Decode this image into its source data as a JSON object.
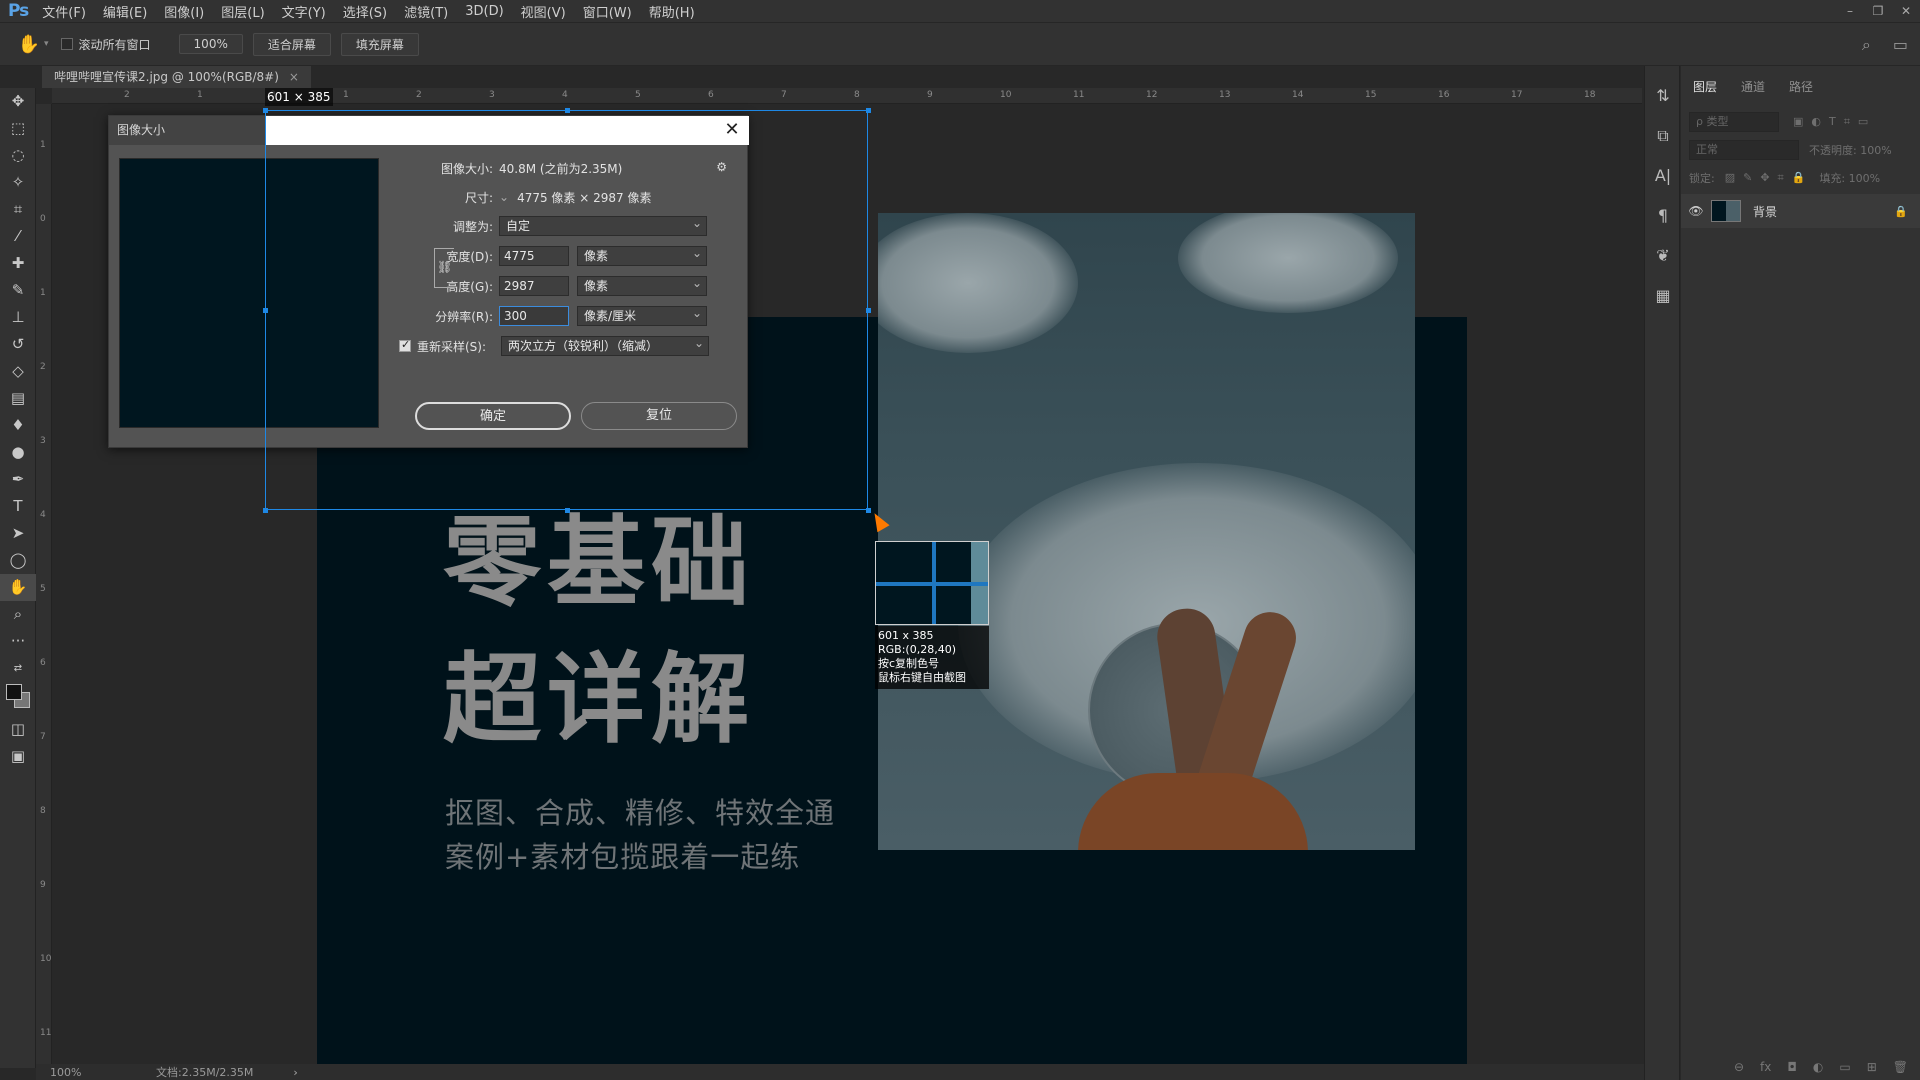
{
  "app": {
    "logo": "Ps"
  },
  "menu": [
    "文件(F)",
    "编辑(E)",
    "图像(I)",
    "图层(L)",
    "文字(Y)",
    "选择(S)",
    "滤镜(T)",
    "3D(D)",
    "视图(V)",
    "窗口(W)",
    "帮助(H)"
  ],
  "window_controls": [
    "–",
    "❐",
    "✕"
  ],
  "options": {
    "scroll_all": "滚动所有窗口",
    "zoom_btn": "100%",
    "fit_screen": "适合屏幕",
    "fill_screen": "填充屏幕"
  },
  "document": {
    "tab_title": "哔哩哔哩宣传课2.jpg @ 100%(RGB/8#)",
    "tab_close": "×"
  },
  "rulers": {
    "h": [
      "2",
      "1",
      "0",
      "1",
      "2",
      "3",
      "4",
      "5",
      "6",
      "7",
      "8",
      "9",
      "10",
      "11",
      "12",
      "13",
      "14",
      "15",
      "16",
      "17",
      "18"
    ],
    "v": [
      "1",
      "0",
      "1",
      "2",
      "3",
      "4",
      "5",
      "6",
      "7",
      "8",
      "9",
      "10",
      "11"
    ]
  },
  "canvas": {
    "headline1": "零基础",
    "headline2": "超详解",
    "subline1": "抠图、合成、精修、特效全通",
    "subline2": "案例+素材包揽跟着一起练"
  },
  "selection": {
    "size_label": "601 × 385"
  },
  "dialog": {
    "title": "图像大小",
    "close": "✕",
    "image_size_label": "图像大小:",
    "image_size_value": "40.8M (之前为2.35M)",
    "gear": "⚙",
    "dimensions_label": "尺寸:",
    "dimensions_value": "4775 像素 × 2987 像素",
    "fit_to_label": "调整为:",
    "fit_to_value": "自定",
    "width_label": "宽度(D):",
    "width_value": "4775",
    "width_unit": "像素",
    "height_label": "高度(G):",
    "height_value": "2987",
    "height_unit": "像素",
    "resolution_label": "分辨率(R):",
    "resolution_value": "300",
    "resolution_unit": "像素/厘米",
    "resample_label": "重新采样(S):",
    "resample_value": "两次立方（较锐利）（缩减）",
    "resample_checked": true,
    "ok": "确定",
    "reset": "复位"
  },
  "picker": {
    "size": "601 x 385",
    "rgb": "RGB:(0,28,40)",
    "hint1": "按c复制色号",
    "hint2": "鼠标右键自由截图"
  },
  "status": {
    "zoom": "100%",
    "doc": "文档:2.35M/2.35M",
    "arrow": "›"
  },
  "layers": {
    "tabs": [
      "图层",
      "通道",
      "路径"
    ],
    "search_placeholder": "ρ 类型",
    "blend_mode": "正常",
    "opacity_label": "不透明度: 100%",
    "lock_label": "锁定:",
    "fill_label": "填充: 100%",
    "layer_name": "背景",
    "footer_icons": [
      "⊖",
      "fx",
      "◘",
      "◐",
      "▭",
      "⊞",
      "🗑"
    ]
  },
  "colors": {
    "accent": "#1e88e5",
    "ps_blue": "#5aa3e6",
    "picked_color": "#001c28"
  }
}
